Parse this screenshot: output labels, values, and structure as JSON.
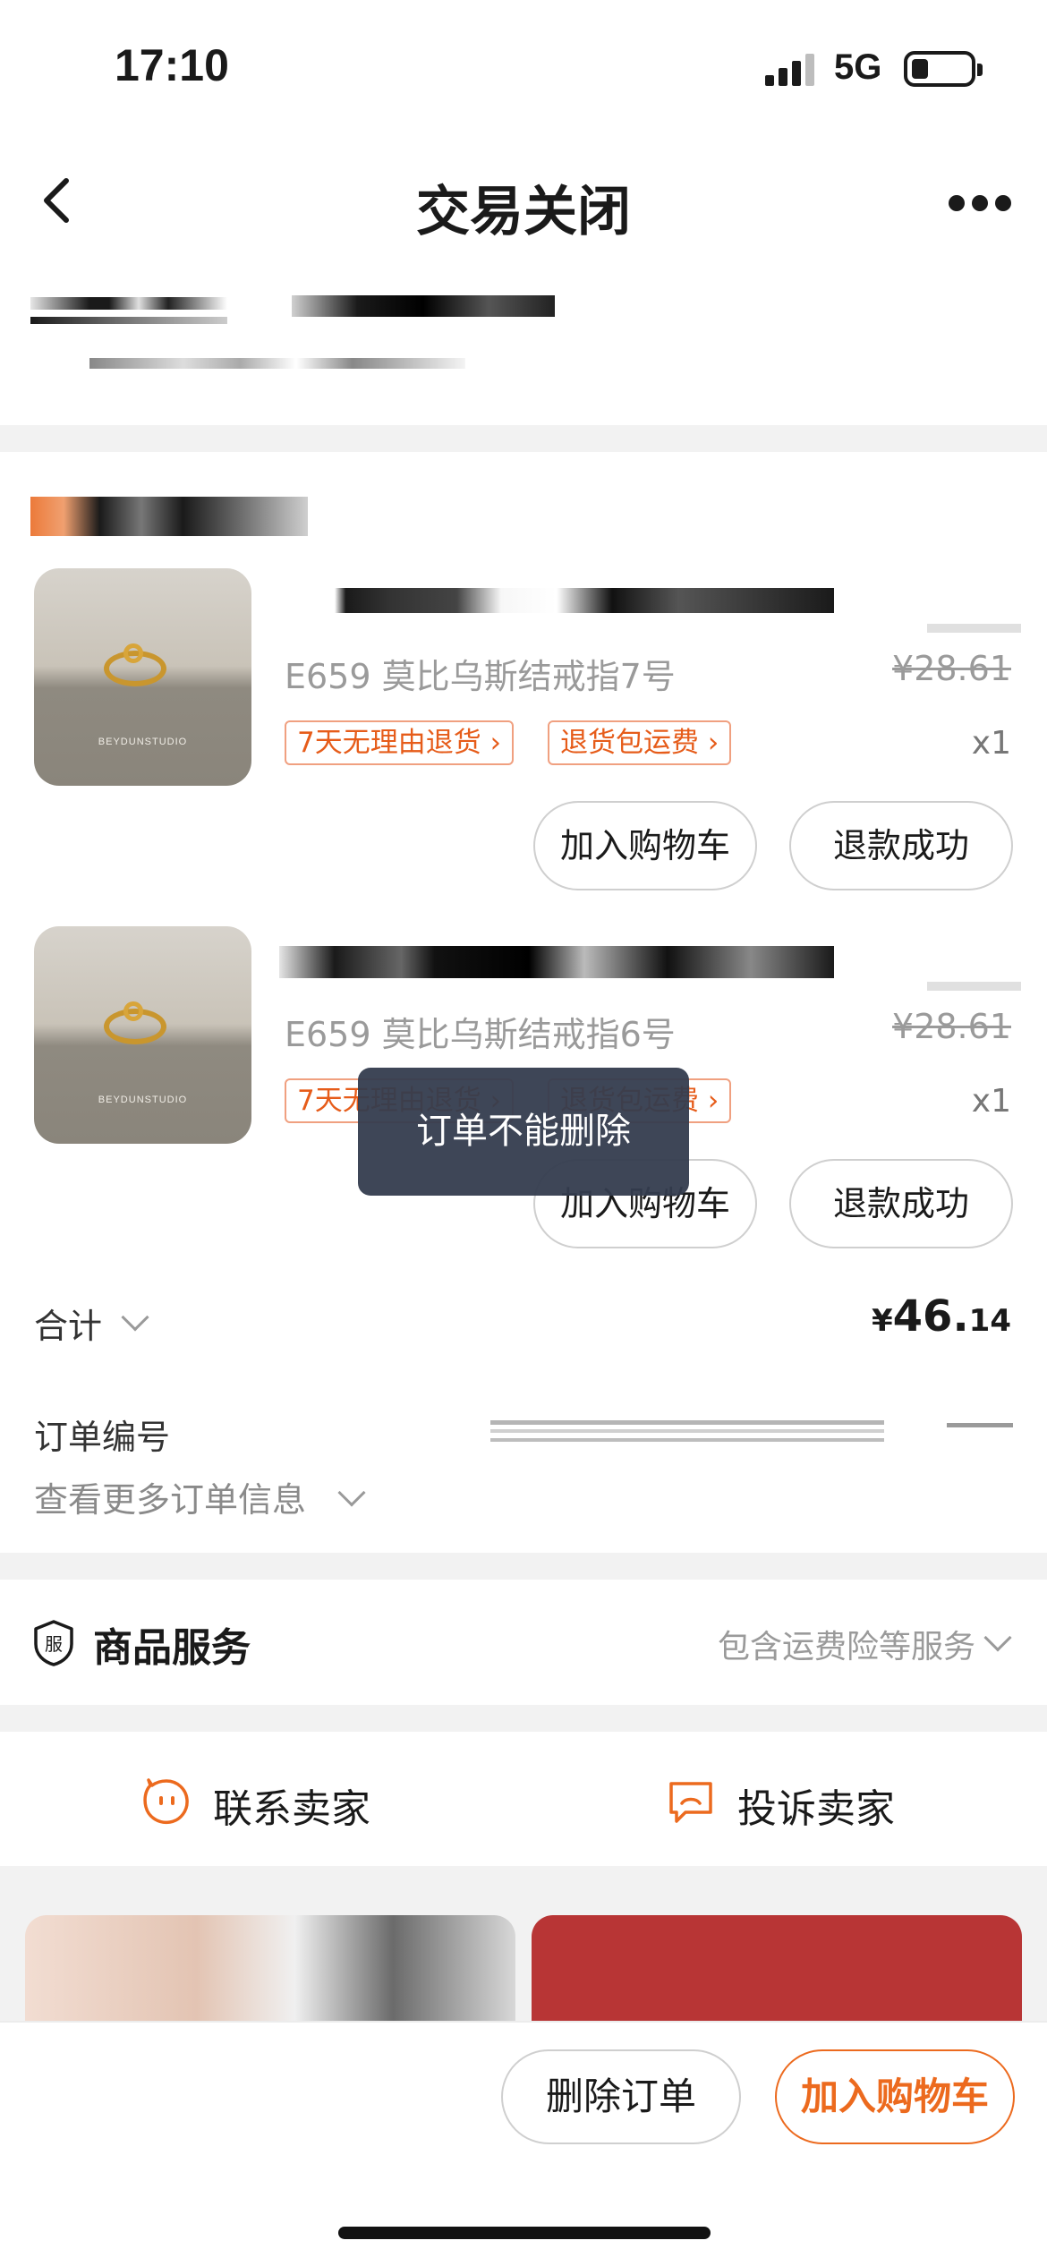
{
  "status_bar": {
    "time": "17:10",
    "network": "5G"
  },
  "nav": {
    "title": "交易关闭"
  },
  "items": [
    {
      "name": "E659 莫比乌斯结戒指7号",
      "original_price": "¥28.61",
      "quantity": "x1",
      "tags": [
        "7天无理由退货 ›",
        "退货包运费 ›"
      ],
      "thumb_brand": "BEYDUNSTUDIO",
      "add_cart_label": "加入购物车",
      "refund_label": "退款成功"
    },
    {
      "name": "E659 莫比乌斯结戒指6号",
      "original_price": "¥28.61",
      "quantity": "x1",
      "tags": [
        "7天无理由退货 ›",
        "退货包运费 ›"
      ],
      "thumb_brand": "BEYDUNSTUDIO",
      "add_cart_label": "加入购物车",
      "refund_label": "退款成功"
    }
  ],
  "summary": {
    "total_label": "合计",
    "currency": "¥",
    "total_int": "46.",
    "total_dec": "14"
  },
  "order_info": {
    "order_no_label": "订单编号",
    "more_info_label": "查看更多订单信息"
  },
  "service": {
    "icon_text": "服",
    "title": "商品服务",
    "description": "包含运费险等服务"
  },
  "contact": {
    "contact_seller": "联系卖家",
    "complain_seller": "投诉卖家"
  },
  "bottom_bar": {
    "delete_label": "删除订单",
    "add_cart_label": "加入购物车"
  },
  "toast": {
    "message": "订单不能删除"
  },
  "colors": {
    "accent": "#ec6a1e",
    "toast_bg": "#343c4e"
  }
}
